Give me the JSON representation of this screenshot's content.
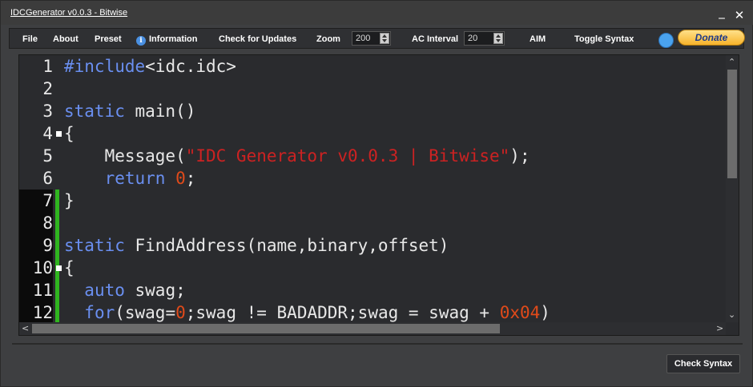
{
  "window": {
    "title": "IDCGenerator v0.0.3 - Bitwise",
    "minimize": "_",
    "close": "✕"
  },
  "menu": {
    "file": "File",
    "about": "About",
    "preset": "Preset",
    "information": "Information",
    "check_updates": "Check for Updates",
    "zoom_label": "Zoom",
    "zoom_value": "200",
    "ac_interval_label": "AC Interval",
    "ac_interval_value": "20",
    "aim": "AIM",
    "toggle_syntax": "Toggle Syntax",
    "donate": "Donate"
  },
  "editor": {
    "line_numbers": [
      "1",
      "2",
      "3",
      "4",
      "5",
      "6",
      "7",
      "8",
      "9",
      "10",
      "11",
      "12"
    ],
    "lines": [
      [
        {
          "t": "#include",
          "c": "kw"
        },
        {
          "t": "<idc.idc>",
          "c": ""
        }
      ],
      [],
      [
        {
          "t": "static",
          "c": "kw"
        },
        {
          "t": " main()",
          "c": ""
        }
      ],
      [
        {
          "t": "{",
          "c": ""
        }
      ],
      [
        {
          "t": "    Message(",
          "c": ""
        },
        {
          "t": "\"IDC Generator v0.0.3 | Bitwise\"",
          "c": "str"
        },
        {
          "t": ");",
          "c": ""
        }
      ],
      [
        {
          "t": "    ",
          "c": ""
        },
        {
          "t": "return",
          "c": "kw"
        },
        {
          "t": " ",
          "c": ""
        },
        {
          "t": "0",
          "c": "num"
        },
        {
          "t": ";",
          "c": ""
        }
      ],
      [
        {
          "t": "}",
          "c": ""
        }
      ],
      [],
      [
        {
          "t": "static",
          "c": "kw"
        },
        {
          "t": " FindAddress(name,binary,offset)",
          "c": ""
        }
      ],
      [
        {
          "t": "{",
          "c": ""
        }
      ],
      [
        {
          "t": "  ",
          "c": ""
        },
        {
          "t": "auto",
          "c": "kw"
        },
        {
          "t": " swag;",
          "c": ""
        }
      ],
      [
        {
          "t": "  ",
          "c": ""
        },
        {
          "t": "for",
          "c": "kw"
        },
        {
          "t": "(swag=",
          "c": ""
        },
        {
          "t": "0",
          "c": "num"
        },
        {
          "t": ";swag != BADADDR;swag = swag + ",
          "c": ""
        },
        {
          "t": "0x04",
          "c": "num"
        },
        {
          "t": ")",
          "c": ""
        }
      ]
    ]
  },
  "footer": {
    "check_syntax": "Check Syntax"
  }
}
